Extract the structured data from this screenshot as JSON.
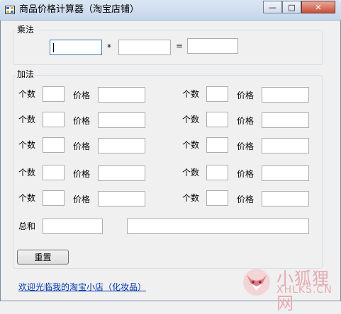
{
  "window": {
    "title": "商品价格计算器（淘宝店铺）"
  },
  "multiply": {
    "group_label": "乘法",
    "operand1": "",
    "operand2": "",
    "result": "",
    "times_sign": "*",
    "equals_sign": "="
  },
  "add": {
    "group_label": "加法",
    "count_label": "个数",
    "price_label": "价格",
    "left_rows": [
      {
        "count": "",
        "price": ""
      },
      {
        "count": "",
        "price": ""
      },
      {
        "count": "",
        "price": ""
      },
      {
        "count": "",
        "price": ""
      },
      {
        "count": "",
        "price": ""
      }
    ],
    "right_rows": [
      {
        "count": "",
        "price": ""
      },
      {
        "count": "",
        "price": ""
      },
      {
        "count": "",
        "price": ""
      },
      {
        "count": "",
        "price": ""
      },
      {
        "count": "",
        "price": ""
      }
    ],
    "total_label": "总和",
    "total_value": "",
    "total_detail": ""
  },
  "reset_button": "重置",
  "shop_link": "欢迎光临我的淘宝小店（化妆品）",
  "watermark": {
    "line1": "小狐狸网",
    "line2": "XHLKS.CN"
  },
  "colors": {
    "titlebar": "#c5d6ea",
    "link": "#0033aa",
    "close": "#c7503a"
  }
}
